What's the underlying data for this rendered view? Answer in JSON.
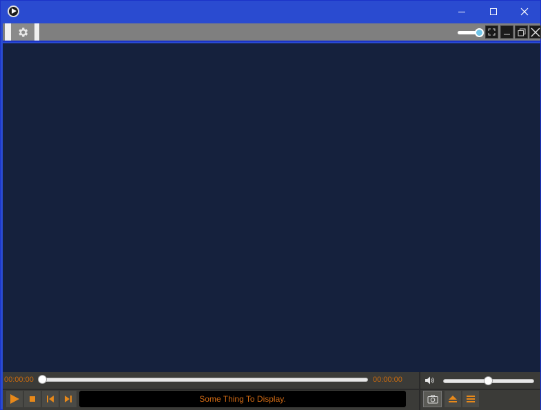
{
  "window": {
    "title": ""
  },
  "titlebar": {
    "buttons": [
      "minimize",
      "maximize",
      "close"
    ]
  },
  "toolbar": {
    "settings_icon": "gear-icon",
    "opacity_level": 0.9,
    "buttons": [
      "fullscreen",
      "minimize",
      "restore",
      "close"
    ]
  },
  "video": {
    "background": "#15213d"
  },
  "controls": {
    "time_current": "00:00:00",
    "time_total": "00:00:00",
    "seek_position": 0.0,
    "volume_level": 0.5,
    "display_text": "Some Thing To Display.",
    "buttons": [
      "play",
      "stop",
      "previous",
      "next",
      "snapshot",
      "eject",
      "playlist"
    ]
  },
  "colors": {
    "titlebar": "#2a4bd0",
    "accent": "#e8891a",
    "time_text": "#c76a10"
  }
}
